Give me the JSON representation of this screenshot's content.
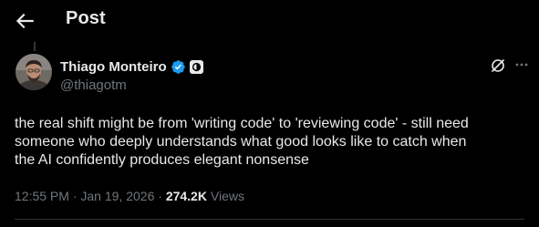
{
  "header": {
    "title": "Post",
    "back_icon": "arrow-left-icon"
  },
  "author": {
    "name": "Thiago Monteiro",
    "handle": "@thiagotm",
    "verified_icon": "verified-badge-icon",
    "affiliate_icon": "affiliate-badge-icon"
  },
  "actions": {
    "grok_icon": "grok-icon",
    "more_icon": "more-horizontal-icon"
  },
  "post": {
    "text_lines": [
      "the real shift might be from 'writing code' to 'reviewing code' - still need",
      "someone who deeply understands what good looks like to catch when",
      "the AI confidently produces elegant nonsense"
    ]
  },
  "meta": {
    "time": "12:55 PM",
    "separator": "·",
    "date": "Jan 19, 2026",
    "views_count": "274.2K",
    "views_label": "Views"
  },
  "colors": {
    "background": "#000000",
    "text": "#e7e9ea",
    "secondary": "#71767b",
    "verified": "#1d9bf0"
  }
}
